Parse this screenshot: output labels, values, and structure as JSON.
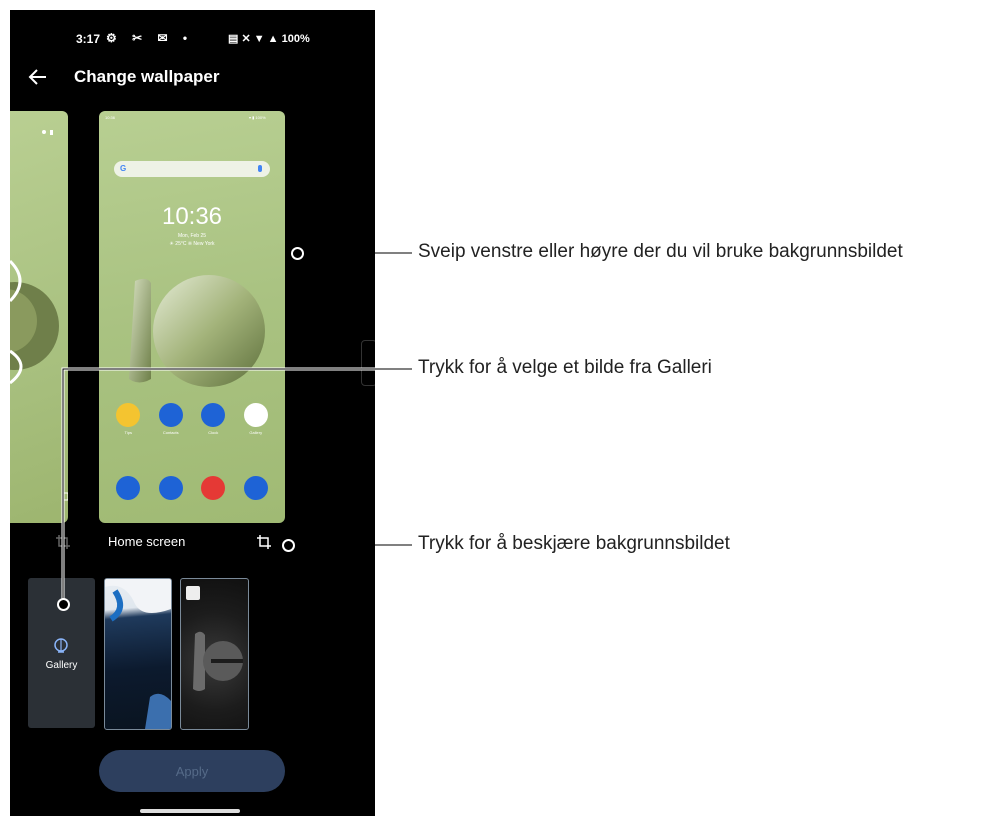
{
  "status_bar": {
    "time": "3:17",
    "left_icons": "⚙ ✂ ✉ •",
    "right_icons": "▤ ✕ ▼ ▲",
    "battery": "100%"
  },
  "app_bar": {
    "title": "Change wallpaper"
  },
  "preview": {
    "mini_time": "10:36",
    "clock": "10:36",
    "date": "Mon, Feb 25",
    "weather": "☀ 25°C ❊ New York",
    "apps_row1": [
      "Tips",
      "Contacts",
      "Clock",
      "Gallery"
    ],
    "label": "Home screen"
  },
  "thumbnails": {
    "gallery_label": "Gallery"
  },
  "apply_button": "Apply",
  "callouts": {
    "swipe": "Sveip venstre eller høyre der du vil bruke bakgrunnsbildet",
    "gallery": "Trykk for å velge et bilde fra Galleri",
    "crop": "Trykk for å beskjære bakgrunnsbildet"
  },
  "colors": {
    "wallpaper_green": "#a9c281",
    "apply_bg": "#2d3f5e",
    "icon_blue": "#1e63d6",
    "icon_yellow": "#f4c430",
    "icon_red": "#e53935"
  }
}
